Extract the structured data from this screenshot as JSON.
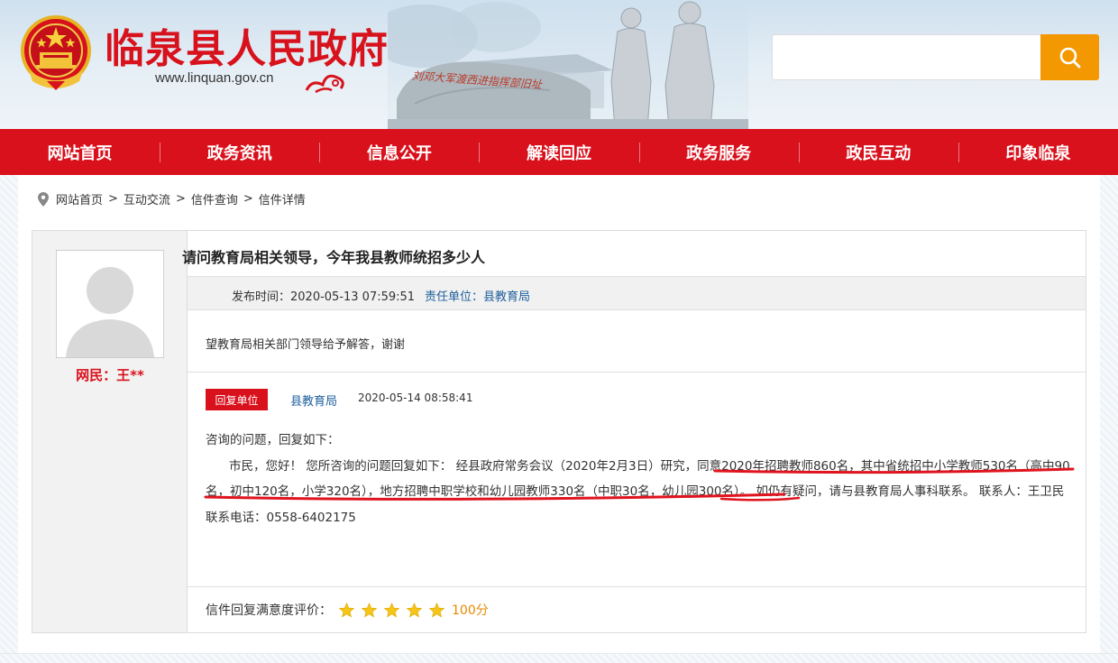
{
  "header": {
    "site_title": "临泉县人民政府",
    "site_url": "www.linquan.gov.cn",
    "photo_caption": "刘邓大军渡西进指挥部旧址",
    "search": {
      "placeholder": ""
    }
  },
  "nav": {
    "items": [
      {
        "label": "网站首页"
      },
      {
        "label": "政务资讯"
      },
      {
        "label": "信息公开"
      },
      {
        "label": "解读回应"
      },
      {
        "label": "政务服务"
      },
      {
        "label": "政民互动"
      },
      {
        "label": "印象临泉"
      }
    ]
  },
  "breadcrumb": {
    "items": [
      {
        "label": "网站首页"
      },
      {
        "label": "互动交流"
      },
      {
        "label": "信件查询"
      },
      {
        "label": "信件详情"
      }
    ],
    "separator": ">"
  },
  "letter": {
    "user_name": "网民：王**",
    "title": "请问教育局相关领导，今年我县教师统招多少人",
    "publish_time": "发布时间：2020-05-13 07:59:51",
    "responsible_unit": "责任单位：县教育局",
    "question": "望教育局相关部门领导给予解答，谢谢"
  },
  "reply": {
    "badge": "回复单位",
    "unit": "县教育局",
    "time": "2020-05-14 08:58:41",
    "intro": "咨询的问题，回复如下：",
    "body": "市民，您好！ 您所咨询的问题回复如下： 经县政府常务会议（2020年2月3日）研究，同意2020年招聘教师860名，其中省统招中小学教师530名（高中90名，初中120名，小学320名），地方招聘中职学校和幼儿园教师330名（中职30名，幼儿园300名）。 如仍有疑问，请与县教育局人事科联系。 联系人：王卫民 联系电话：0558-6402175"
  },
  "rating": {
    "label": "信件回复满意度评价：",
    "stars": 5,
    "max_stars": 5,
    "score": "100分"
  },
  "colors": {
    "brand_red": "#d9111c",
    "search_orange": "#f39800",
    "link_blue": "#1d5e9c",
    "star_gold": "#f5c518"
  }
}
